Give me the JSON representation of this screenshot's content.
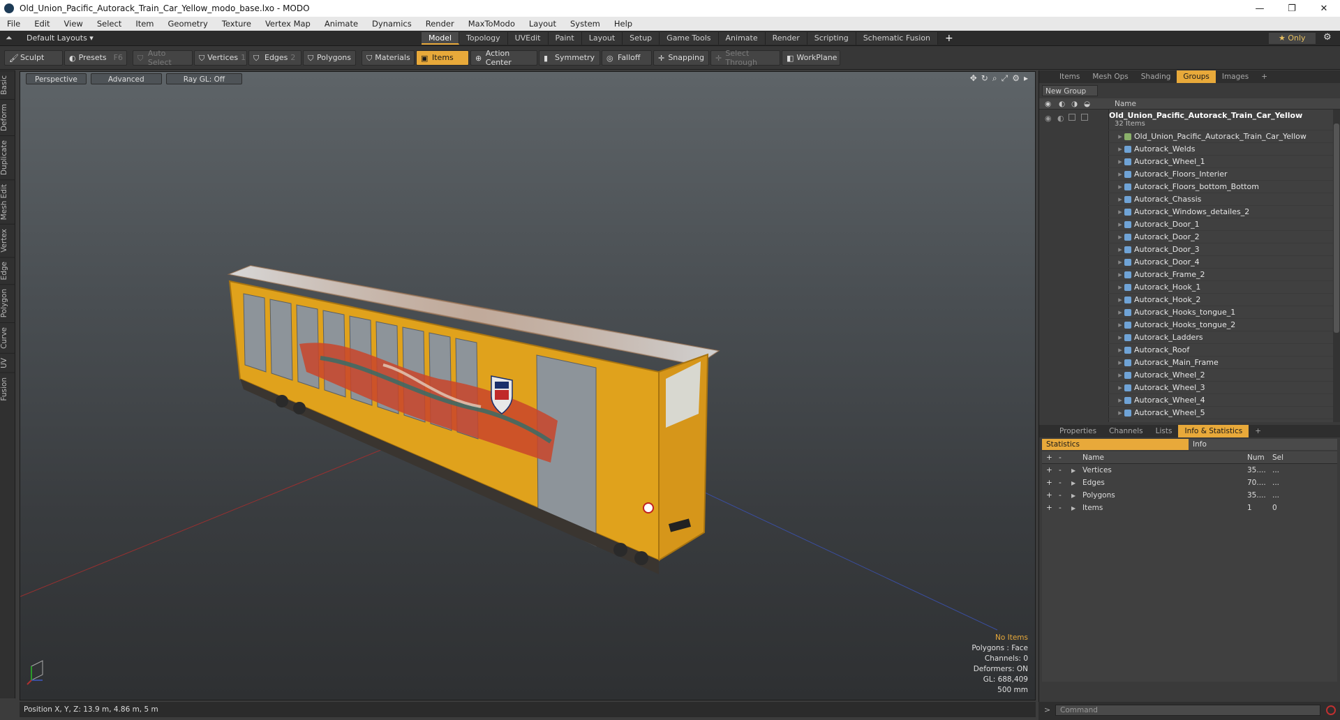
{
  "window": {
    "title": "Old_Union_Pacific_Autorack_Train_Car_Yellow_modo_base.lxo - MODO"
  },
  "menu": [
    "File",
    "Edit",
    "View",
    "Select",
    "Item",
    "Geometry",
    "Texture",
    "Vertex Map",
    "Animate",
    "Dynamics",
    "Render",
    "MaxToModo",
    "Layout",
    "System",
    "Help"
  ],
  "layoutbar": {
    "layouts_label": "Default Layouts ▾",
    "tabs": [
      "Model",
      "Topology",
      "UVEdit",
      "Paint",
      "Layout",
      "Setup",
      "Game Tools",
      "Animate",
      "Render",
      "Scripting",
      "Schematic Fusion"
    ],
    "active_tab": "Model",
    "only_label": "★  Only"
  },
  "toolbar": {
    "sculpt": "Sculpt",
    "presets": "Presets",
    "presets_key": "F6",
    "auto_select": "Auto Select",
    "vertices": "Vertices",
    "vertices_num": "1",
    "edges": "Edges",
    "edges_num": "2",
    "polygons": "Polygons",
    "materials": "Materials",
    "items": "Items",
    "action_center": "Action Center",
    "symmetry": "Symmetry",
    "falloff": "Falloff",
    "snapping": "Snapping",
    "select_through": "Select Through",
    "workplane": "WorkPlane"
  },
  "lefttabs": [
    "Basic",
    "Deform",
    "Duplicate",
    "Mesh Edit",
    "Vertex",
    "Edge",
    "Polygon",
    "Curve",
    "UV",
    "Fusion"
  ],
  "viewport": {
    "view": "Perspective",
    "shading": "Advanced",
    "raygl": "Ray GL: Off",
    "info": {
      "no_items": "No Items",
      "polygons": "Polygons : Face",
      "channels": "Channels: 0",
      "deformers": "Deformers: ON",
      "gl": "GL: 688,409",
      "scale": "500 mm"
    }
  },
  "status": {
    "position": "Position X, Y, Z:   13.9 m, 4.86 m, 5 m"
  },
  "panel_top": {
    "tabs": [
      "Items",
      "Mesh Ops",
      "Shading",
      "Groups",
      "Images"
    ],
    "active_tab": "Groups",
    "new_group": "New Group",
    "name_header": "Name",
    "group_name": "Old_Union_Pacific_Autorack_Train_Car_Yellow",
    "group_count": "32 Items",
    "items": [
      "Old_Union_Pacific_Autorack_Train_Car_Yellow",
      "Autorack_Welds",
      "Autorack_Wheel_1",
      "Autorack_Floors_Interier",
      "Autorack_Floors_bottom_Bottom",
      "Autorack_Chassis",
      "Autorack_Windows_detailes_2",
      "Autorack_Door_1",
      "Autorack_Door_2",
      "Autorack_Door_3",
      "Autorack_Door_4",
      "Autorack_Frame_2",
      "Autorack_Hook_1",
      "Autorack_Hook_2",
      "Autorack_Hooks_tongue_1",
      "Autorack_Hooks_tongue_2",
      "Autorack_Ladders",
      "Autorack_Roof",
      "Autorack_Main_Frame",
      "Autorack_Wheel_2",
      "Autorack_Wheel_3",
      "Autorack_Wheel_4",
      "Autorack_Wheel_5"
    ]
  },
  "panel_bottom": {
    "tabs": [
      "Properties",
      "Channels",
      "Lists",
      "Info & Statistics"
    ],
    "active_tab": "Info & Statistics",
    "sub_statistics": "Statistics",
    "sub_info": "Info",
    "headers": {
      "name": "Name",
      "num": "Num",
      "sel": "Sel"
    },
    "rows": [
      {
        "name": "Vertices",
        "num": "35....",
        "sel": "..."
      },
      {
        "name": "Edges",
        "num": "70....",
        "sel": "..."
      },
      {
        "name": "Polygons",
        "num": "35....",
        "sel": "..."
      },
      {
        "name": "Items",
        "num": "1",
        "sel": "0"
      }
    ]
  },
  "command": {
    "placeholder": "Command"
  },
  "colors": {
    "accent": "#e8a93a",
    "mesh_icon": "#6fa3d6"
  }
}
